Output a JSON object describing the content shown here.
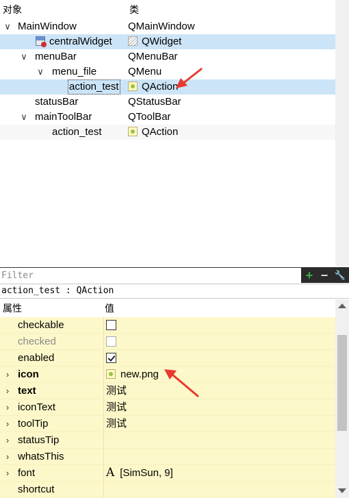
{
  "object_inspector": {
    "col_object": "对象",
    "col_class": "类",
    "rows": [
      {
        "name": "MainWindow",
        "cls": "QMainWindow"
      },
      {
        "name": "centralWidget",
        "cls": "QWidget"
      },
      {
        "name": "menuBar",
        "cls": "QMenuBar"
      },
      {
        "name": "menu_file",
        "cls": "QMenu"
      },
      {
        "name": "action_test",
        "cls": "QAction"
      },
      {
        "name": "statusBar",
        "cls": "QStatusBar"
      },
      {
        "name": "mainToolBar",
        "cls": "QToolBar"
      },
      {
        "name": "action_test",
        "cls": "QAction"
      }
    ]
  },
  "filter": {
    "placeholder": "Filter",
    "add_label": "+",
    "remove_label": "−",
    "configure_label": "🔧"
  },
  "caption": "action_test : QAction",
  "property_editor": {
    "col_property": "属性",
    "col_value": "值",
    "rows": [
      {
        "name": "checkable",
        "value": ""
      },
      {
        "name": "checked",
        "value": ""
      },
      {
        "name": "enabled",
        "value": ""
      },
      {
        "name": "icon",
        "value": "new.png"
      },
      {
        "name": "text",
        "value": "测试"
      },
      {
        "name": "iconText",
        "value": "测试"
      },
      {
        "name": "toolTip",
        "value": "测试"
      },
      {
        "name": "statusTip",
        "value": ""
      },
      {
        "name": "whatsThis",
        "value": ""
      },
      {
        "name": "font",
        "value": "[SimSun, 9]",
        "glyph": "A"
      },
      {
        "name": "shortcut",
        "value": ""
      }
    ]
  },
  "colors": {
    "selection": "#cce4f7",
    "property_row": "#fdf8c9",
    "annotation_arrow": "#e83a2e",
    "add_button": "#3cb043"
  }
}
